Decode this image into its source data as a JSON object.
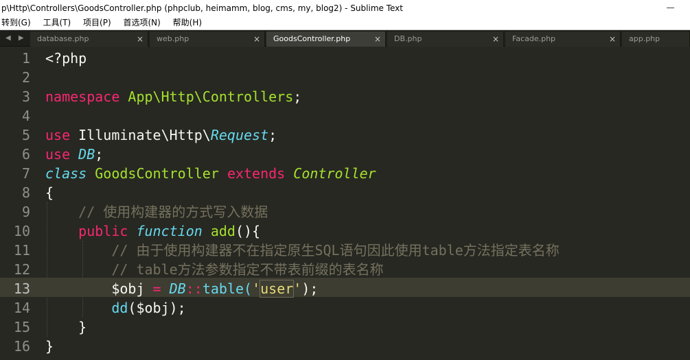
{
  "window": {
    "title": "p\\Http\\Controllers\\GoodsController.php (phpclub, heimamm, blog, cms, my, blog2) - Sublime Text"
  },
  "menu": [
    "转到(G)",
    "工具(T)",
    "项目(P)",
    "首选项(N)",
    "帮助(H)"
  ],
  "tabs": [
    {
      "label": "database.php",
      "active": false
    },
    {
      "label": "web.php",
      "active": false
    },
    {
      "label": "GoodsController.php",
      "active": true
    },
    {
      "label": "DB.php",
      "active": false
    },
    {
      "label": "Facade.php",
      "active": false
    },
    {
      "label": "app.php",
      "active": false
    }
  ],
  "tab_close_glyph": "×",
  "nav_arrows": "◀ ▶",
  "editor": {
    "current_line": 13,
    "line_numbers": [
      "1",
      "2",
      "3",
      "4",
      "5",
      "6",
      "7",
      "8",
      "9",
      "10",
      "11",
      "12",
      "13",
      "14",
      "15",
      "16"
    ],
    "code": {
      "l1": "<?php",
      "l3_kw": "namespace",
      "l3_ns": "App\\Http\\Controllers",
      "l3_end": ";",
      "l5_kw": "use",
      "l5_ns": "Illuminate\\Http\\",
      "l5_cls": "Request",
      "l5_end": ";",
      "l6_kw": "use",
      "l6_cls": "DB",
      "l6_end": ";",
      "l7_kw": "class",
      "l7_name": "GoodsController",
      "l7_ext": "extends",
      "l7_parent": "Controller",
      "l8": "{",
      "l9": "// 使用构建器的方式写入数据",
      "l10_kw": "public",
      "l10_fn": "function",
      "l10_name": "add",
      "l10_end": "(){",
      "l11": "// 由于使用构建器不在指定原生SQL语句因此使用table方法指定表名称",
      "l12": "// table方法参数指定不带表前缀的表名称",
      "l13_var": "$obj ",
      "l13_eq": "=",
      "l13_cls": "DB",
      "l13_op": "::",
      "l13_method": "table(",
      "l13_q1": "'",
      "l13_str": "user",
      "l13_q2": "'",
      "l13_end": ");",
      "l14_fn": "dd",
      "l14_rest": "($obj);",
      "l15": "}",
      "l16": "}"
    }
  },
  "colors": {
    "background": "#272822",
    "keyword": "#f92672",
    "entity": "#a6e22e",
    "support": "#66d9ef",
    "comment": "#75715e",
    "string": "#e6db74"
  }
}
